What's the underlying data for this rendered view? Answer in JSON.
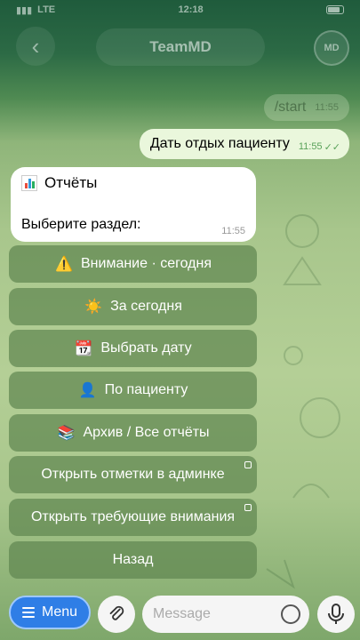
{
  "status_bar": {
    "carrier": "LTE",
    "time": "12:18"
  },
  "header": {
    "back_icon": "chevron-left-icon",
    "title": "TeamMD",
    "avatar_initials": "MD"
  },
  "messages": {
    "ghost_out": {
      "text": "/start",
      "time": "11:55"
    },
    "out": {
      "text": "Дать отдых пациенту",
      "time": "11:55"
    },
    "in": {
      "title": "Отчёты",
      "text": "Выберите раздел:",
      "time": "11:55"
    }
  },
  "keyboard": [
    {
      "emoji": "⚠️",
      "label": "Внимание · сегодня"
    },
    {
      "emoji": "☀️",
      "label": "За сегодня"
    },
    {
      "emoji": "📆",
      "label": "Выбрать дату"
    },
    {
      "emoji": "👤",
      "label": "По пациенту"
    },
    {
      "emoji": "📚",
      "label": "Архив / Все отчёты"
    },
    {
      "emoji": "",
      "label": "Открыть отметки в админке"
    },
    {
      "emoji": "",
      "label": "Открыть требующие внимания"
    },
    {
      "emoji": "",
      "label": "Назад"
    }
  ],
  "bottom": {
    "menu_label": "Menu",
    "input_placeholder": "Message"
  },
  "colors": {
    "accent": "#2f7ee6",
    "keyboard_button": "#5f8750",
    "outgoing_bubble": "#eaf7dc"
  }
}
